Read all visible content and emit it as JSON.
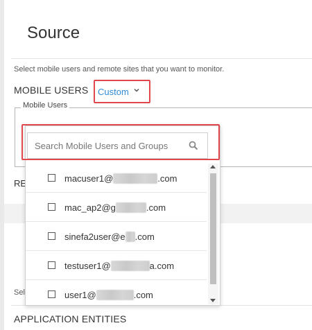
{
  "page": {
    "title": "Source",
    "description": "Select mobile users and remote sites that you want to monitor."
  },
  "mobile_users": {
    "label": "MOBILE USERS",
    "mode_selector": "Custom",
    "fieldset_legend": "Mobile Users"
  },
  "remote_sites": {
    "label_partial": "RE"
  },
  "lower_section": {
    "select_partial": "Sel",
    "application_entities_label": "APPLICATION ENTITIES"
  },
  "dropdown": {
    "search_placeholder": "Search Mobile Users and Groups",
    "items": [
      {
        "prefix": "macuser1@",
        "suffix": ".com",
        "checked": false
      },
      {
        "prefix": "mac_ap2@g",
        "suffix": ".com",
        "checked": false
      },
      {
        "prefix": "sinefa2user@e",
        "suffix": ".com",
        "checked": false
      },
      {
        "prefix": "testuser1@",
        "suffix": "a.com",
        "checked": false
      },
      {
        "prefix": "user1@",
        "suffix": ".com",
        "checked": false
      }
    ]
  },
  "colors": {
    "highlight_border": "#e0474c",
    "link_blue": "#2e8bd6"
  }
}
